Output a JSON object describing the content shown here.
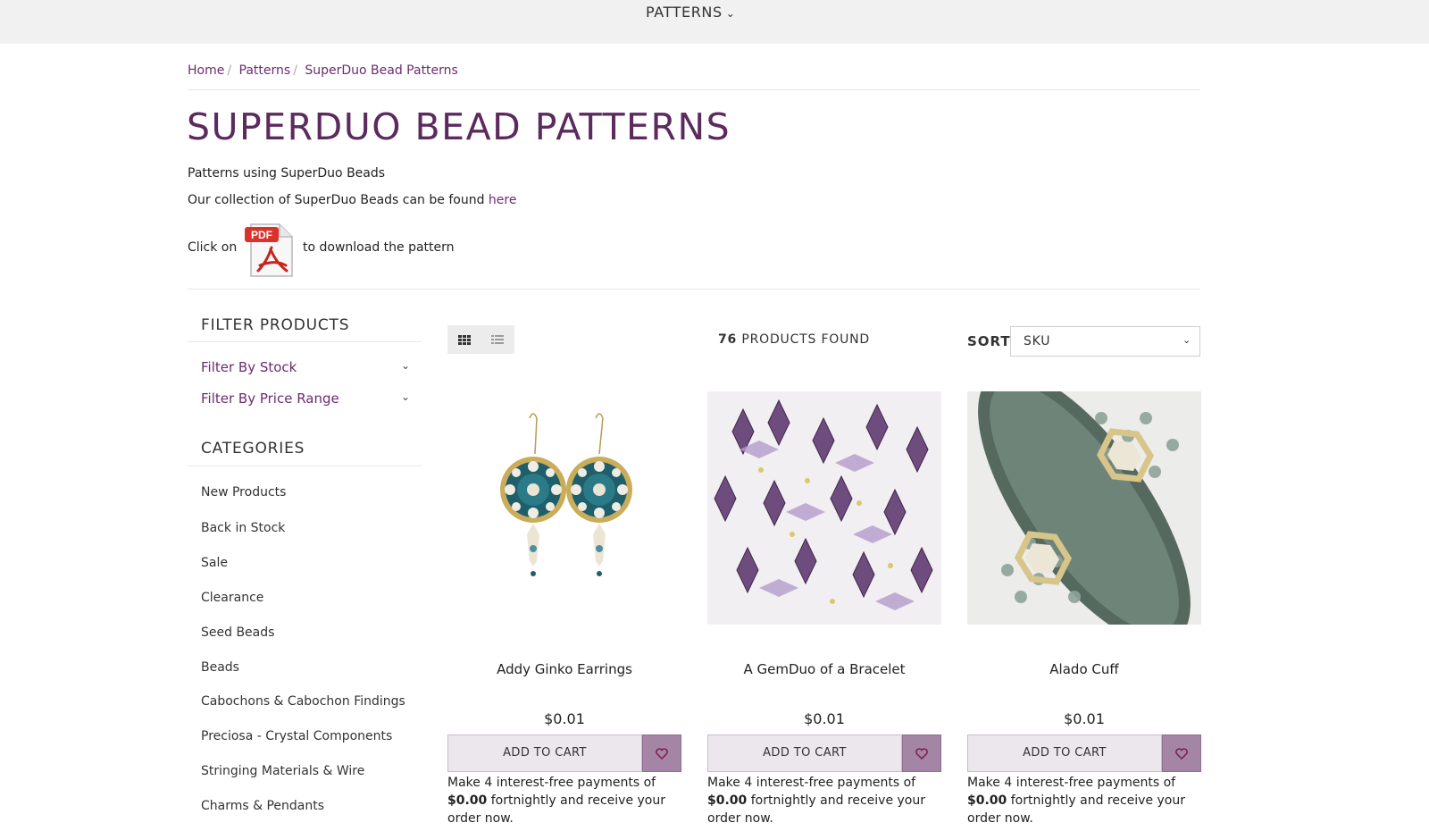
{
  "nav": {
    "patterns_label": "PATTERNS"
  },
  "breadcrumb": {
    "home": "Home",
    "patterns": "Patterns",
    "current": "SuperDuo Bead Patterns",
    "separator": "/"
  },
  "page": {
    "title": "SUPERDUO BEAD PATTERNS",
    "line1": "Patterns using SuperDuo Beads",
    "line2_prefix": "Our collection of SuperDuo Beads can be found",
    "line2_link": "here",
    "line3_prefix": "Click on",
    "line3_suffix": "to download the pattern",
    "pdf_label": "PDF"
  },
  "sidebar": {
    "filter_heading": "FILTER PRODUCTS",
    "filters": [
      {
        "label": "Filter By Stock"
      },
      {
        "label": "Filter By Price Range"
      }
    ],
    "categories_heading": "CATEGORIES",
    "categories": [
      "New Products",
      "Back in Stock",
      "Sale",
      "Clearance",
      "Seed Beads",
      "Beads",
      "Cabochons & Cabochon Findings",
      "Preciosa - Crystal Components",
      "Stringing Materials & Wire",
      "Charms & Pendants"
    ]
  },
  "toolbar": {
    "products_count": "76",
    "products_found_label": "PRODUCTS FOUND",
    "sort_label": "SORT",
    "sort_value": "SKU"
  },
  "products": [
    {
      "name": "Addy Ginko Earrings",
      "price": "$0.01",
      "cart_label": "ADD TO CART",
      "afterpay_prefix": "Make 4 interest-free payments of",
      "afterpay_amount": "$0.00",
      "afterpay_suffix": "fortnightly and receive your order now."
    },
    {
      "name": "A GemDuo of a Bracelet",
      "price": "$0.01",
      "cart_label": "ADD TO CART",
      "afterpay_prefix": "Make 4 interest-free payments of",
      "afterpay_amount": "$0.00",
      "afterpay_suffix": "fortnightly and receive your order now."
    },
    {
      "name": "Alado Cuff",
      "price": "$0.01",
      "cart_label": "ADD TO CART",
      "afterpay_prefix": "Make 4 interest-free payments of",
      "afterpay_amount": "$0.00",
      "afterpay_suffix": "fortnightly and receive your order now."
    }
  ],
  "icons": {
    "nav_chevron": "chevron-down-icon",
    "grid_view": "grid-view-icon",
    "list_view": "list-view-icon",
    "wishlist": "heart-icon",
    "pdf": "pdf-icon"
  },
  "colors": {
    "brand_purple": "#5b2a5e",
    "link_purple": "#6b2c6e",
    "wishlist_bg": "#a585a6",
    "cart_bg": "#ece7ed"
  }
}
